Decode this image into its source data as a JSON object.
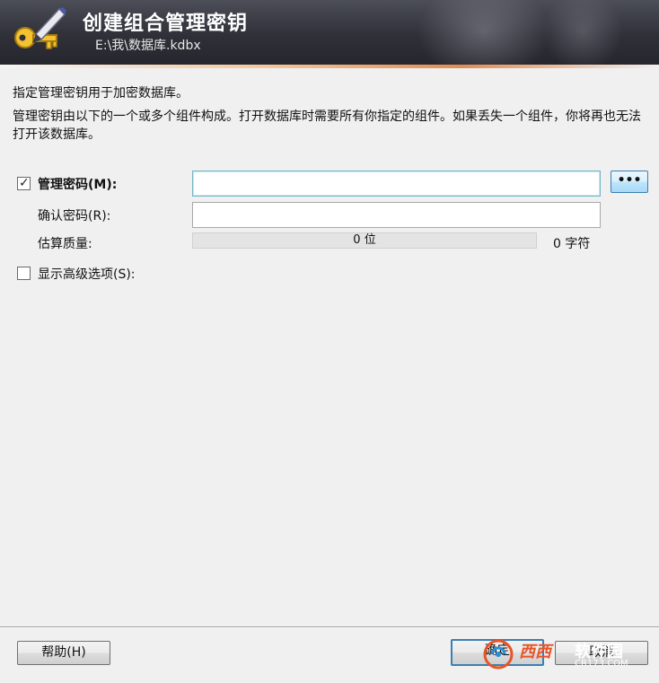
{
  "header": {
    "title": "创建组合管理密钥",
    "file_path": "E:\\我\\数据库.kdbx"
  },
  "intro": {
    "line1": "指定管理密钥用于加密数据库。",
    "line2": "管理密钥由以下的一个或多个组件构成。打开数据库时需要所有你指定的组件。如果丢失一个组件，你将再也无法打开该数据库。"
  },
  "form": {
    "master_password": {
      "label": "管理密码(M):",
      "checked": true,
      "value": ""
    },
    "reveal_button_label": "•••",
    "confirm_password": {
      "label": "确认密码(R):",
      "value": ""
    },
    "quality": {
      "label": "估算质量:",
      "bits_text": "0 位",
      "chars_text": "0 字符",
      "fill_fraction": 0
    },
    "show_advanced": {
      "label": "显示高级选项(S):",
      "checked": false
    }
  },
  "footer": {
    "help_label": "帮助(H)",
    "ok_label": "确定",
    "cancel_label": "取消"
  },
  "watermark": {
    "brand_left": "西西",
    "brand_right": "软件园",
    "domain": "CR173.COM"
  },
  "colors": {
    "banner_dark": "#2f3038",
    "accent_orange": "#e08d55",
    "focus_border": "#6fb5c4"
  },
  "icons": {
    "banner": "key-and-pen-icon",
    "reveal": "ellipsis-icon"
  }
}
